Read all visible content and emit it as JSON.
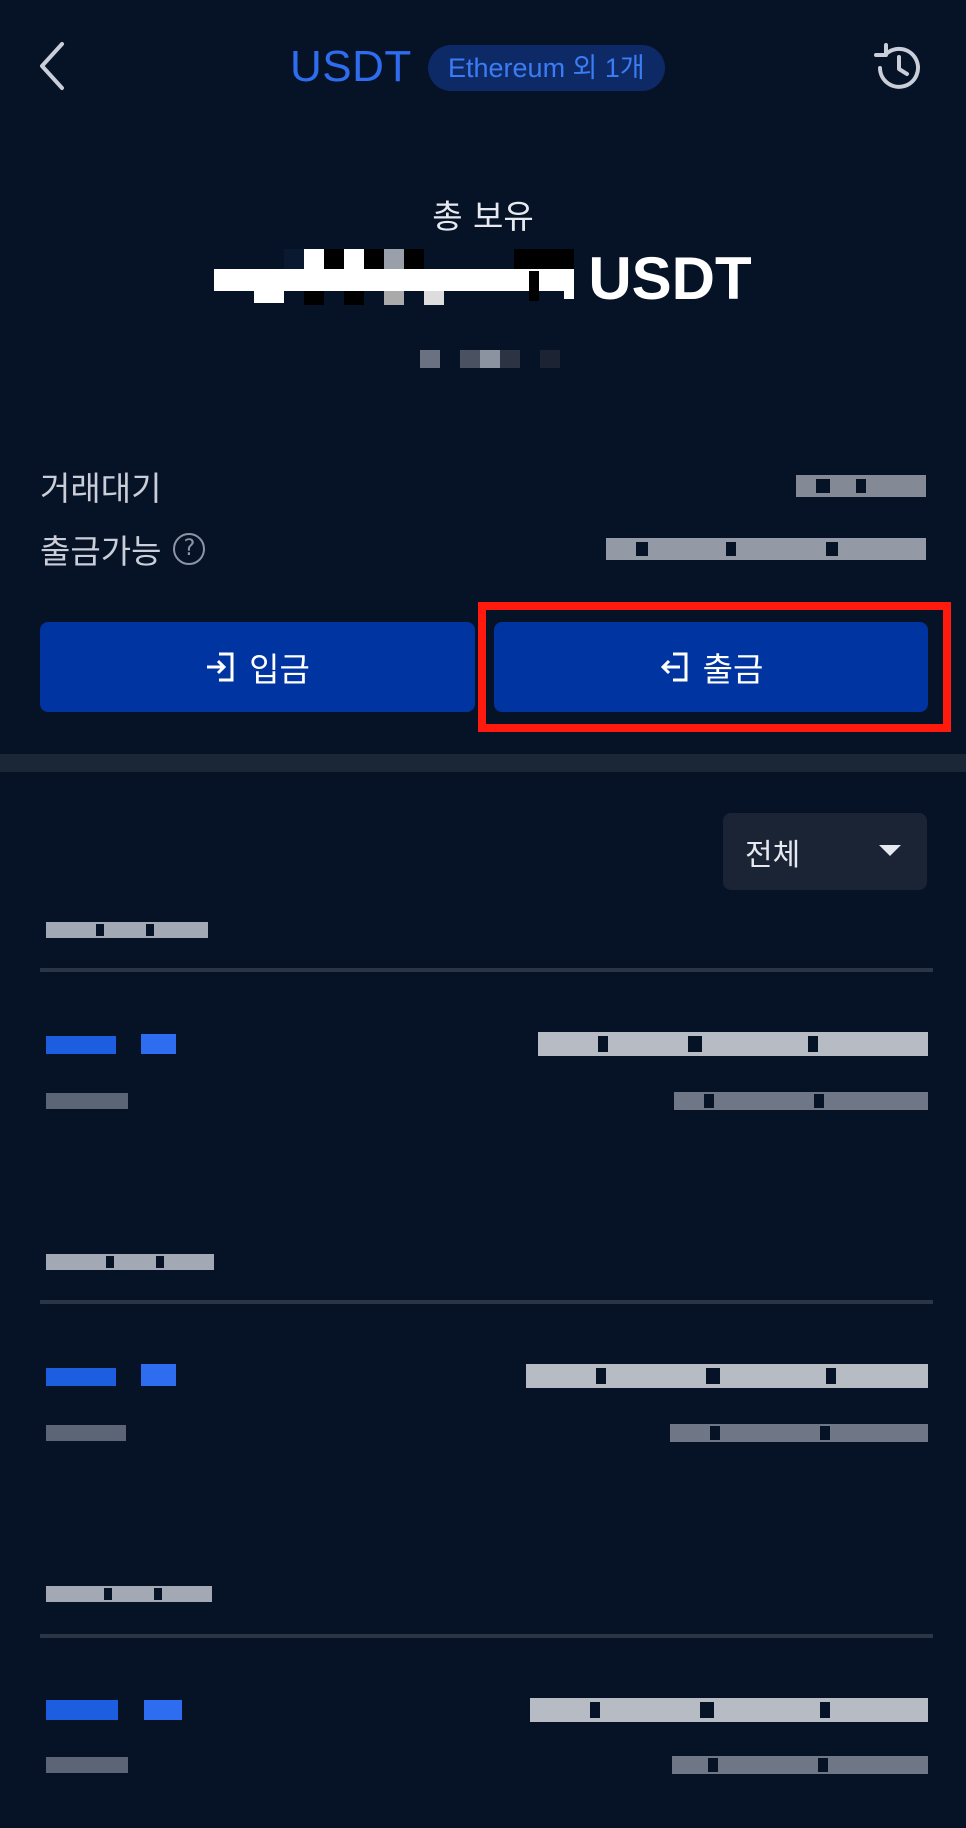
{
  "header": {
    "title": "USDT",
    "network_badge": "Ethereum 외 1개",
    "icons": {
      "back": "chevron-left-icon",
      "history": "history-clock-icon"
    }
  },
  "balance": {
    "label": "총 보유",
    "unit": "USDT"
  },
  "info": {
    "pending_label": "거래대기",
    "available_label": "출금가능",
    "help_icon": "?"
  },
  "actions": {
    "deposit_label": "입금",
    "withdraw_label": "출금"
  },
  "filter": {
    "selected": "전체"
  },
  "colors": {
    "background": "#061226",
    "accent": "#2e6cf0",
    "button": "#0034a0",
    "highlight": "#ff1a0d"
  }
}
